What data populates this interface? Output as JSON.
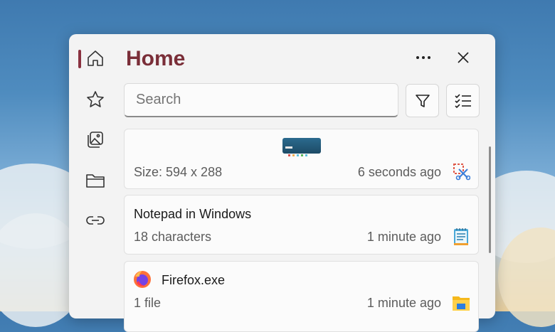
{
  "window": {
    "title": "Home"
  },
  "nav": {
    "items": [
      {
        "id": "home",
        "icon": "home-icon",
        "active": true
      },
      {
        "id": "favorites",
        "icon": "star-icon"
      },
      {
        "id": "images",
        "icon": "images-icon"
      },
      {
        "id": "files",
        "icon": "folder-icon"
      },
      {
        "id": "links",
        "icon": "link-icon"
      }
    ]
  },
  "header": {
    "more_icon": "more-icon",
    "close_icon": "close-icon"
  },
  "search": {
    "placeholder": "Search"
  },
  "toolbar": {
    "filter_icon": "filter-icon",
    "select_icon": "checklist-icon"
  },
  "clips": [
    {
      "type": "image",
      "meta_left": "Size: 594 x 288",
      "meta_right": "6 seconds ago",
      "app_icon": "snipping-tool-icon"
    },
    {
      "type": "text",
      "title": "Notepad in Windows",
      "meta_left": "18 characters",
      "meta_right": "1 minute ago",
      "app_icon": "notepad-icon"
    },
    {
      "type": "file",
      "title": "Firefox.exe",
      "meta_left": "1 file",
      "meta_right": "1 minute ago",
      "app_icon": "file-explorer-icon",
      "file_icon": "firefox-icon"
    }
  ],
  "colors": {
    "accent": "#7a2e38",
    "panel": "#f3f3f3"
  }
}
